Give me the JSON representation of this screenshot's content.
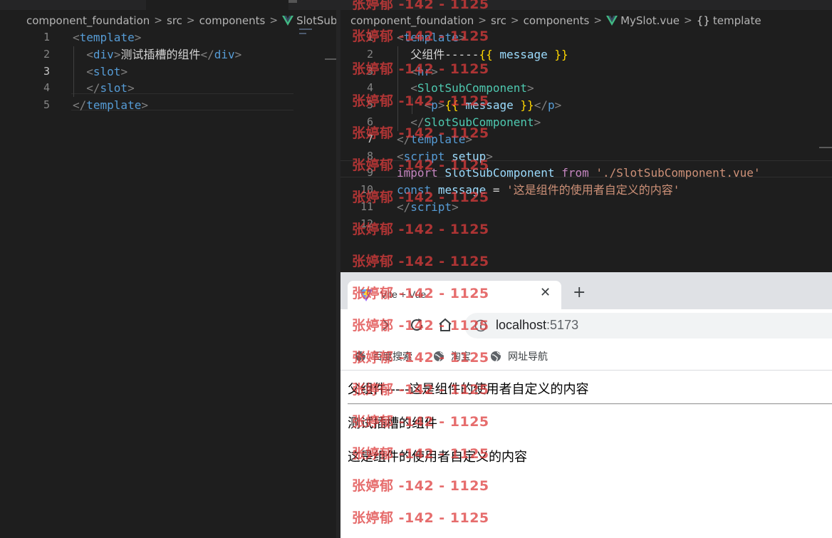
{
  "left_editor": {
    "breadcrumb": [
      "component_foundation",
      "src",
      "components",
      "SlotSubCo"
    ],
    "active_line": 3,
    "lines": [
      {
        "n": "1",
        "tokens": [
          [
            "c-punc",
            "<"
          ],
          [
            "c-tag",
            "template"
          ],
          [
            "c-punc",
            ">"
          ]
        ]
      },
      {
        "n": "2",
        "tokens": [
          [
            "c-text",
            "  "
          ],
          [
            "c-punc",
            "<"
          ],
          [
            "c-tag",
            "div"
          ],
          [
            "c-punc",
            ">"
          ],
          [
            "c-text",
            "测试插槽的组件"
          ],
          [
            "c-punc",
            "</"
          ],
          [
            "c-tag",
            "div"
          ],
          [
            "c-punc",
            ">"
          ]
        ]
      },
      {
        "n": "3",
        "tokens": [
          [
            "c-text",
            "  "
          ],
          [
            "c-punc",
            "<"
          ],
          [
            "c-tag",
            "slot"
          ],
          [
            "c-punc",
            ">"
          ]
        ]
      },
      {
        "n": "4",
        "tokens": [
          [
            "c-text",
            "  "
          ],
          [
            "c-punc",
            "</"
          ],
          [
            "c-tag",
            "slot"
          ],
          [
            "c-punc",
            ">"
          ]
        ]
      },
      {
        "n": "5",
        "tokens": [
          [
            "c-punc",
            "</"
          ],
          [
            "c-tag",
            "template"
          ],
          [
            "c-punc",
            ">"
          ]
        ]
      }
    ]
  },
  "right_editor": {
    "breadcrumb": [
      "component_foundation",
      "src",
      "components",
      "MySlot.vue",
      "template"
    ],
    "active_line": 7,
    "lines": [
      {
        "n": "1",
        "tokens": [
          [
            "c-punc",
            "<"
          ],
          [
            "c-tag",
            "template"
          ],
          [
            "c-punc",
            ">"
          ]
        ]
      },
      {
        "n": "2",
        "tokens": [
          [
            "c-text",
            "  父组件-----"
          ],
          [
            "c-brace",
            "{{"
          ],
          [
            "c-var",
            " message "
          ],
          [
            "c-brace",
            "}}"
          ]
        ]
      },
      {
        "n": "3",
        "tokens": [
          [
            "c-text",
            "  "
          ],
          [
            "c-punc",
            "<"
          ],
          [
            "c-tag",
            "hr"
          ],
          [
            "c-punc",
            ">"
          ]
        ]
      },
      {
        "n": "4",
        "tokens": [
          [
            "c-text",
            "  "
          ],
          [
            "c-punc",
            "<"
          ],
          [
            "c-comp",
            "SlotSubComponent"
          ],
          [
            "c-punc",
            ">"
          ]
        ]
      },
      {
        "n": "5",
        "tokens": [
          [
            "c-text",
            "    "
          ],
          [
            "c-punc",
            "<"
          ],
          [
            "c-tag",
            "p"
          ],
          [
            "c-punc",
            ">"
          ],
          [
            "c-brace",
            "{{"
          ],
          [
            "c-var",
            " message "
          ],
          [
            "c-brace",
            "}}"
          ],
          [
            "c-punc",
            "</"
          ],
          [
            "c-tag",
            "p"
          ],
          [
            "c-punc",
            ">"
          ]
        ]
      },
      {
        "n": "6",
        "tokens": [
          [
            "c-text",
            "  "
          ],
          [
            "c-punc",
            "</"
          ],
          [
            "c-comp",
            "SlotSubComponent"
          ],
          [
            "c-punc",
            ">"
          ]
        ]
      },
      {
        "n": "7",
        "tokens": [
          [
            "c-punc",
            "</"
          ],
          [
            "c-tag",
            "template"
          ],
          [
            "c-punc",
            ">"
          ]
        ]
      },
      {
        "n": "8",
        "tokens": [
          [
            "c-punc",
            "<"
          ],
          [
            "c-tag",
            "script"
          ],
          [
            "c-text",
            " "
          ],
          [
            "c-attr",
            "setup"
          ],
          [
            "c-punc",
            ">"
          ]
        ]
      },
      {
        "n": "9",
        "tokens": [
          [
            "c-key",
            "import"
          ],
          [
            "c-text",
            " "
          ],
          [
            "c-var",
            "SlotSubComponent"
          ],
          [
            "c-text",
            " "
          ],
          [
            "c-key",
            "from"
          ],
          [
            "c-text",
            " "
          ],
          [
            "c-str",
            "'./SlotSubComponent.vue'"
          ]
        ]
      },
      {
        "n": "10",
        "tokens": [
          [
            "c-const",
            "const"
          ],
          [
            "c-text",
            " "
          ],
          [
            "c-var",
            "message"
          ],
          [
            "c-text",
            " = "
          ],
          [
            "c-str",
            "'这是组件的使用者自定义的内容'"
          ]
        ]
      },
      {
        "n": "11",
        "tokens": [
          [
            "c-punc",
            "</"
          ],
          [
            "c-tag",
            "script"
          ],
          [
            "c-punc",
            ">"
          ]
        ]
      },
      {
        "n": "12",
        "tokens": []
      }
    ]
  },
  "browser": {
    "tab_title": "Vite + Vue",
    "close_glyph": "✕",
    "newtab_glyph": "+",
    "url_host": "localhost",
    "url_port": ":5173",
    "bookmarks": [
      "百度搜索",
      "淘宝",
      "网址导航"
    ],
    "page": {
      "line1": "父组件-----这是组件的使用者自定义的内容",
      "line2": "测试插槽的组件",
      "line3": "这是组件的使用者自定义的内容"
    }
  },
  "watermark": "张婷郁 -142 - 1125",
  "colors": {
    "editor_bg": "#1e1e1e",
    "tag": "#569cd6",
    "component": "#4ec9b0",
    "string": "#ce9178",
    "keyword": "#c586c0",
    "variable": "#9cdcfe",
    "brace": "#ffd700",
    "watermark": "#de3c3c"
  }
}
